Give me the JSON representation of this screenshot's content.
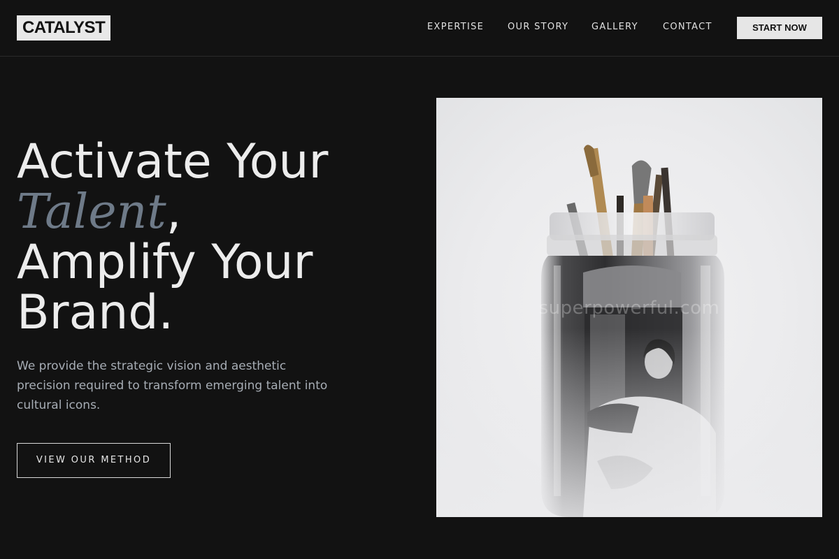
{
  "header": {
    "logo": "CATALYST",
    "nav": [
      "EXPERTISE",
      "OUR STORY",
      "GALLERY",
      "CONTACT"
    ],
    "cta": "START NOW"
  },
  "hero": {
    "headline_line1": "Activate Your",
    "headline_italic": "Talent",
    "headline_comma": ",",
    "headline_line3": "Amplify Your",
    "headline_line4": "Brand.",
    "subtext": "We provide the strategic vision and aesthetic precision required to transform emerging talent into cultural icons.",
    "button": "VIEW OUR METHOD"
  },
  "image": {
    "watermark": "superpowerful.com",
    "colors": {
      "background": "#ececee",
      "jar_glass": "#3a3a3a",
      "brush_wood": "#b08a52"
    }
  },
  "colors": {
    "page_background": "#121212",
    "accent_italic": "#6e7a88",
    "body_text": "#a7adb5",
    "logo_background": "#e8e8e8"
  }
}
